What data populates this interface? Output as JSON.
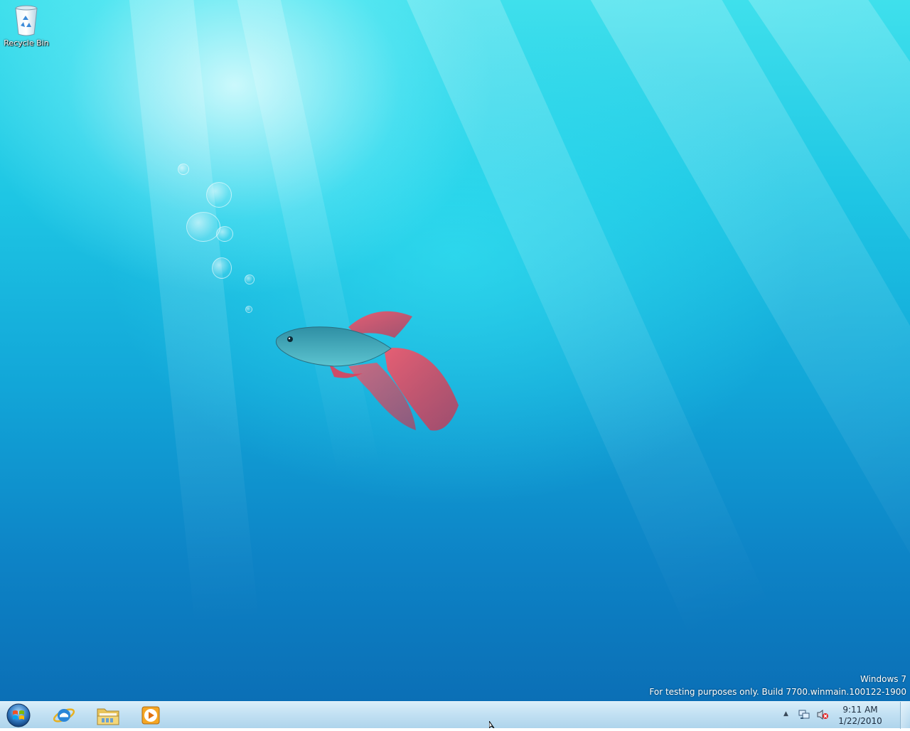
{
  "desktop": {
    "icons": [
      {
        "label": "Recycle Bin",
        "icon": "recycle-bin-icon"
      }
    ],
    "watermark": {
      "line1": "Windows 7",
      "line2": "For testing purposes only. Build 7700.winmain.100122-1900"
    }
  },
  "taskbar": {
    "start_icon": "windows-orb-icon",
    "pinned": [
      {
        "name": "Internet Explorer",
        "icon": "internet-explorer-icon"
      },
      {
        "name": "Windows Explorer",
        "icon": "folder-icon"
      },
      {
        "name": "Windows Media Player",
        "icon": "media-player-icon"
      }
    ],
    "tray": {
      "icons": [
        "show-hidden-icons-arrow-icon",
        "network-icon",
        "volume-muted-icon"
      ],
      "time": "9:11 AM",
      "date": "1/22/2010"
    }
  },
  "colors": {
    "desktop_top": "#3fe0ec",
    "desktop_bottom": "#0b6fb6",
    "taskbar": "#c3e1f3",
    "fish_body": "#3a9fb0",
    "fish_fins": "#e0405a"
  }
}
